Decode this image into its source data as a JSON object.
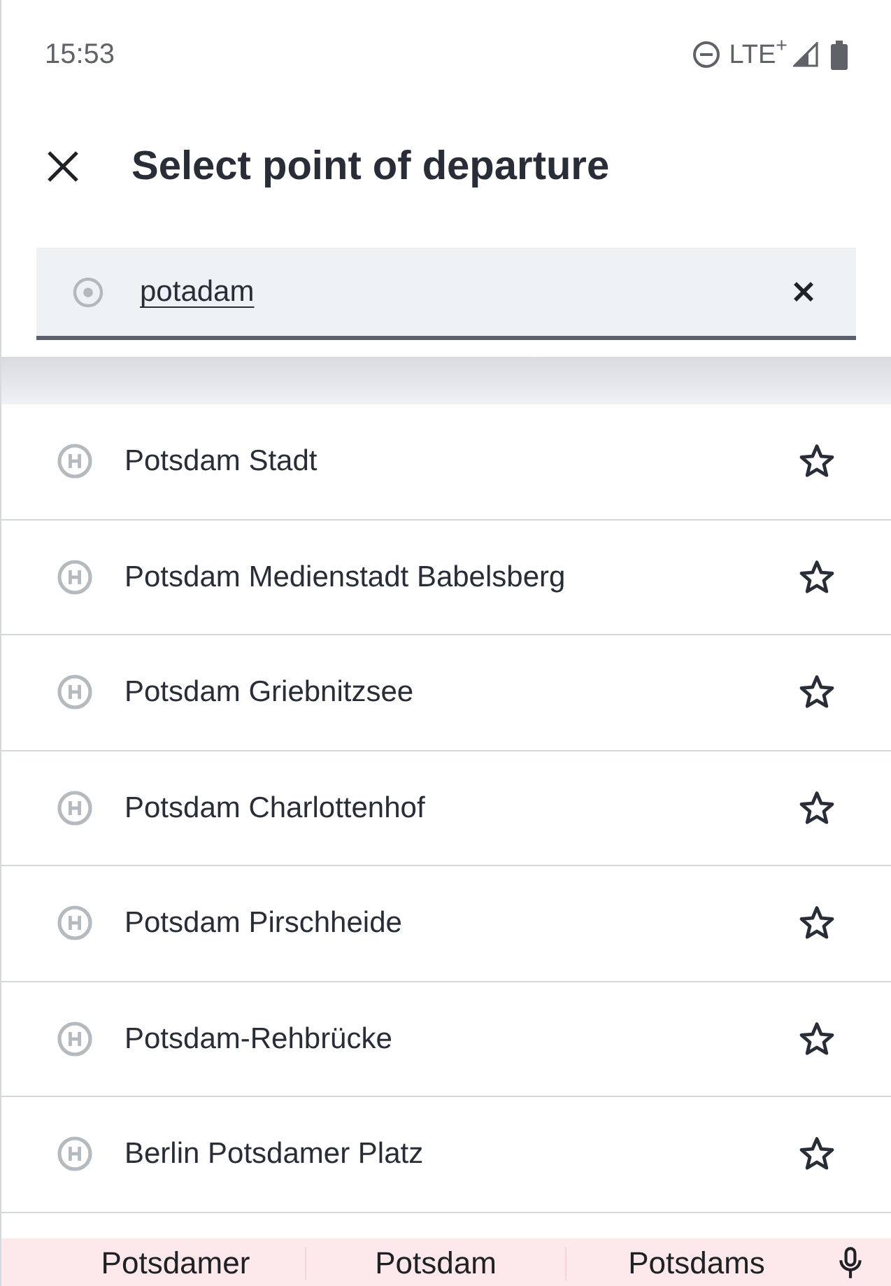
{
  "status_bar": {
    "time": "15:53",
    "network": "LTE$^{+}$"
  },
  "header": {
    "title": "Select point of departure"
  },
  "search": {
    "value": "potadam"
  },
  "results": [
    {
      "name": "Potsdam Stadt",
      "favorite": false
    },
    {
      "name": "Potsdam Medienstadt Babelsberg",
      "favorite": false
    },
    {
      "name": "Potsdam Griebnitzsee",
      "favorite": false
    },
    {
      "name": "Potsdam Charlottenhof",
      "favorite": false
    },
    {
      "name": "Potsdam Pirschheide",
      "favorite": false
    },
    {
      "name": "Potsdam-Rehbrücke",
      "favorite": false
    },
    {
      "name": "Berlin Potsdamer Platz",
      "favorite": false
    }
  ],
  "keyboard_suggestions": [
    "Potsdamer",
    "Potsdam",
    "Potsdams"
  ]
}
